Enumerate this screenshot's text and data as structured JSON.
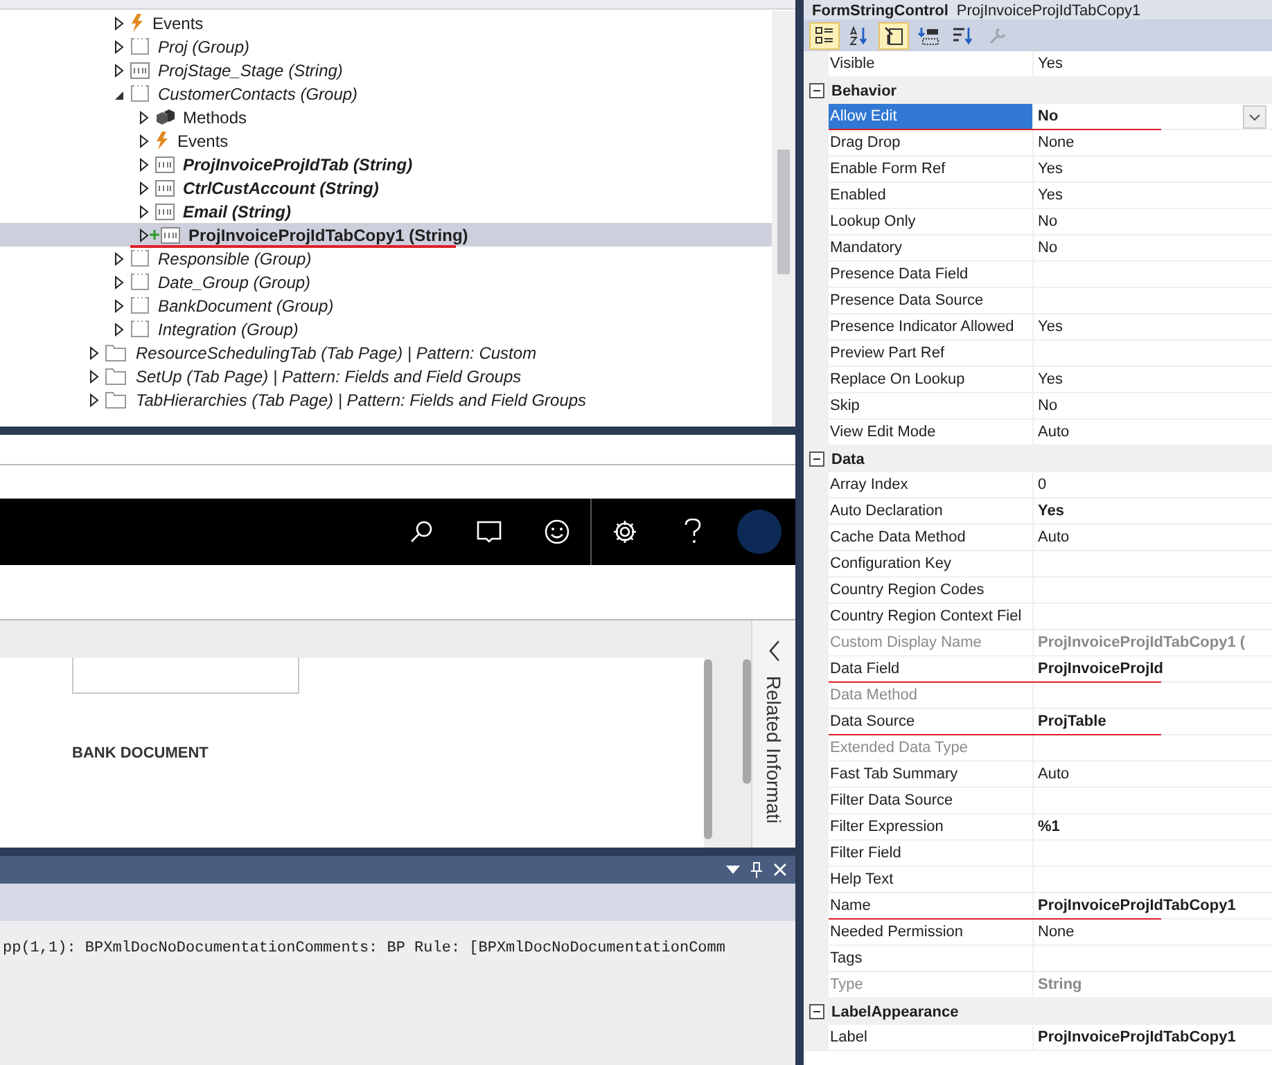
{
  "tree": {
    "partial_branch": [
      {
        "label": "Events",
        "kind": "events",
        "expanded": false,
        "selected": false
      },
      {
        "label": "Proj (Group)",
        "kind": "group",
        "italic": true,
        "expanded": false,
        "selected": false
      },
      {
        "label": "ProjStage_Stage (String)",
        "kind": "string",
        "italic": true,
        "expanded": false,
        "selected": false
      },
      {
        "label": "CustomerContacts (Group)",
        "kind": "group",
        "italic": true,
        "expanded": true,
        "selected": false,
        "children": [
          {
            "label": "Methods",
            "kind": "methods",
            "expanded": false,
            "selected": false
          },
          {
            "label": "Events",
            "kind": "events",
            "expanded": false,
            "selected": false
          },
          {
            "label": "ProjInvoiceProjIdTab (String)",
            "kind": "string",
            "italic": true,
            "bold": true,
            "expanded": false,
            "selected": false
          },
          {
            "label": "CtrlCustAccount (String)",
            "kind": "string",
            "italic": true,
            "bold": true,
            "expanded": false,
            "selected": false
          },
          {
            "label": "Email (String)",
            "kind": "string",
            "italic": true,
            "bold": true,
            "expanded": false,
            "selected": false
          },
          {
            "label": "ProjInvoiceProjIdTabCopy1 (String)",
            "kind": "string",
            "bold": true,
            "expanded": false,
            "selected": true,
            "added": true,
            "marked": true
          }
        ]
      },
      {
        "label": "Responsible (Group)",
        "kind": "group",
        "italic": true,
        "expanded": false,
        "selected": false
      },
      {
        "label": "Date_Group (Group)",
        "kind": "group",
        "italic": true,
        "expanded": false,
        "selected": false
      },
      {
        "label": "BankDocument (Group)",
        "kind": "group",
        "italic": true,
        "expanded": false,
        "selected": false
      },
      {
        "label": "Integration (Group)",
        "kind": "group",
        "italic": true,
        "expanded": false,
        "selected": false
      }
    ],
    "items": [
      {
        "label": "ResourceSchedulingTab (Tab Page) | Pattern: Custom",
        "kind": "folder",
        "italic": true,
        "expanded": false,
        "selected": false
      },
      {
        "label": "SetUp (Tab Page) | Pattern: Fields and Field Groups",
        "kind": "folder",
        "italic": true,
        "expanded": false,
        "selected": false
      },
      {
        "label": "TabHierarchies (Tab Page) | Pattern: Fields and Field Groups",
        "kind": "folder",
        "italic": true,
        "expanded": false,
        "selected": false
      }
    ]
  },
  "browser": {
    "nav_icons": [
      {
        "kind": "search"
      },
      {
        "kind": "comment"
      },
      {
        "kind": "smiley"
      },
      {
        "kind": "settings"
      },
      {
        "kind": "help"
      },
      {
        "kind": "avatar"
      }
    ],
    "section_heading": "BANK DOCUMENT",
    "side_panel_title": "Related Informati"
  },
  "output": {
    "lines": [
      "pp(1,1):  BPXmlDocNoDocumentationComments: BP Rule: [BPXmlDocNoDocumentationComm"
    ]
  },
  "properties": {
    "title": "FormStringControl",
    "object_name": "ProjInvoiceProjIdTabCopy1",
    "toolbar": [
      {
        "kind": "categorized",
        "selected": true
      },
      {
        "kind": "alphabetical",
        "selected": false
      },
      {
        "kind": "properties",
        "selected": true
      },
      {
        "kind": "events",
        "selected": false
      },
      {
        "kind": "sort",
        "selected": false
      },
      {
        "kind": "wrench",
        "selected": false,
        "disabled": true
      }
    ],
    "leading_rows": [
      {
        "name": "Visible",
        "value": "Yes",
        "selected": false
      }
    ],
    "categories": [
      {
        "name": "Behavior",
        "expanded": true,
        "rows": [
          {
            "name": "Allow Edit",
            "value": "No",
            "bold": true,
            "selected": true,
            "marked": true
          },
          {
            "name": "Drag Drop",
            "value": "None",
            "selected": false
          },
          {
            "name": "Enable Form Ref",
            "value": "Yes",
            "selected": false
          },
          {
            "name": "Enabled",
            "value": "Yes",
            "selected": false
          },
          {
            "name": "Lookup Only",
            "value": "No",
            "selected": false
          },
          {
            "name": "Mandatory",
            "value": "No",
            "selected": false
          },
          {
            "name": "Presence Data Field",
            "selected": false
          },
          {
            "name": "Presence Data Source",
            "selected": false
          },
          {
            "name": "Presence Indicator Allowed",
            "value": "Yes",
            "selected": false
          },
          {
            "name": "Preview Part Ref",
            "selected": false
          },
          {
            "name": "Replace On Lookup",
            "value": "Yes",
            "selected": false
          },
          {
            "name": "Skip",
            "value": "No",
            "selected": false
          },
          {
            "name": "View Edit Mode",
            "value": "Auto",
            "selected": false
          }
        ]
      },
      {
        "name": "Data",
        "expanded": true,
        "rows": [
          {
            "name": "Array Index",
            "value": "0",
            "selected": false
          },
          {
            "name": "Auto Declaration",
            "value": "Yes",
            "bold": true,
            "selected": false
          },
          {
            "name": "Cache Data Method",
            "value": "Auto",
            "selected": false
          },
          {
            "name": "Configuration Key",
            "selected": false
          },
          {
            "name": "Country Region Codes",
            "selected": false
          },
          {
            "name": "Country Region Context Fiel",
            "selected": false
          },
          {
            "name": "Custom Display Name",
            "value": "ProjInvoiceProjIdTabCopy1 (",
            "bold": true,
            "dimmed": true,
            "selected": false
          },
          {
            "name": "Data Field",
            "value": "ProjInvoiceProjId",
            "bold": true,
            "marked": true,
            "selected": false
          },
          {
            "name": "Data Method",
            "dimmed": true,
            "selected": false
          },
          {
            "name": "Data Source",
            "value": "ProjTable",
            "bold": true,
            "marked": true,
            "selected": false
          },
          {
            "name": "Extended Data Type",
            "dimmed": true,
            "selected": false
          },
          {
            "name": "Fast Tab Summary",
            "value": "Auto",
            "selected": false
          },
          {
            "name": "Filter Data Source",
            "selected": false
          },
          {
            "name": "Filter Expression",
            "value": "%1",
            "bold": true,
            "selected": false
          },
          {
            "name": "Filter Field",
            "selected": false
          },
          {
            "name": "Help Text",
            "selected": false
          },
          {
            "name": "Name",
            "value": "ProjInvoiceProjIdTabCopy1",
            "bold": true,
            "marked": true,
            "selected": false
          },
          {
            "name": "Needed Permission",
            "value": "None",
            "selected": false
          },
          {
            "name": "Tags",
            "selected": false
          },
          {
            "name": "Type",
            "value": "String",
            "bold": true,
            "dimmed": true,
            "selected": false
          }
        ]
      },
      {
        "name": "LabelAppearance",
        "expanded": true,
        "rows": [
          {
            "name": "Label",
            "value": "ProjInvoiceProjIdTabCopy1",
            "bold": true,
            "selected": false
          }
        ]
      }
    ]
  }
}
